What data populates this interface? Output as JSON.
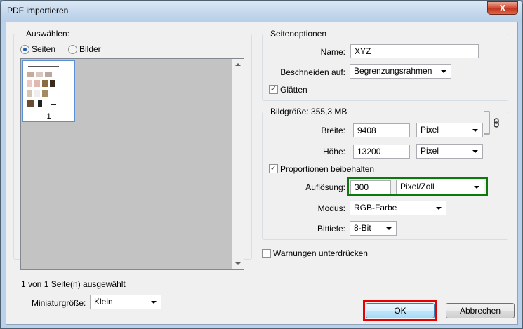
{
  "window": {
    "title": "PDF importieren",
    "close_label": "X"
  },
  "left_panel": {
    "group_label": "Auswählen:",
    "radio_pages": "Seiten",
    "radio_images": "Bilder",
    "thumbnail_number": "1",
    "selection_status": "1 von 1 Seite(n) ausgewählt",
    "thumb_size_label": "Miniaturgröße:",
    "thumb_size_value": "Klein"
  },
  "page_options": {
    "group_label": "Seitenoptionen",
    "name_label": "Name:",
    "name_value": "XYZ",
    "crop_label": "Beschneiden auf:",
    "crop_value": "Begrenzungsrahmen",
    "smooth_label": "Glätten",
    "smooth_checked": true
  },
  "image_size": {
    "group_label": "Bildgröße: 355,3 MB",
    "width_label": "Breite:",
    "width_value": "9408",
    "width_unit": "Pixel",
    "height_label": "Höhe:",
    "height_value": "13200",
    "height_unit": "Pixel",
    "constrain_label": "Proportionen beibehalten",
    "constrain_checked": true,
    "resolution_label": "Auflösung:",
    "resolution_value": "300",
    "resolution_unit": "Pixel/Zoll",
    "mode_label": "Modus:",
    "mode_value": "RGB-Farbe",
    "depth_label": "Bittiefe:",
    "depth_value": "8-Bit"
  },
  "suppress_warnings_label": "Warnungen unterdrücken",
  "buttons": {
    "ok": "OK",
    "cancel": "Abbrechen"
  },
  "colors": {
    "highlight_resolution": "#0b7a0b",
    "highlight_ok": "#e60000"
  }
}
